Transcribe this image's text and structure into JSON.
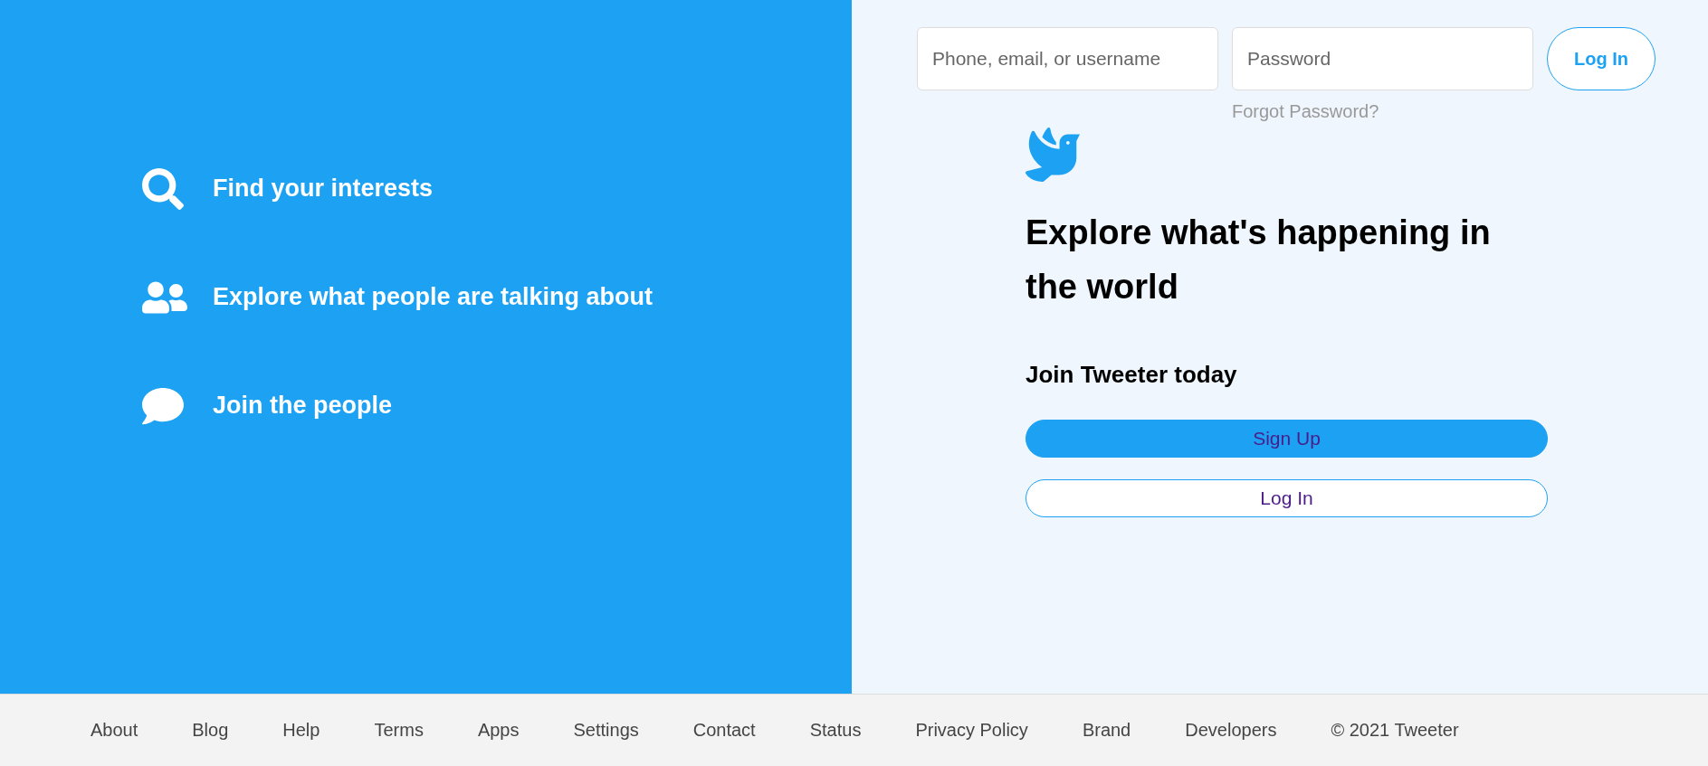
{
  "features": [
    {
      "kind": "search",
      "text": "Find your interests"
    },
    {
      "kind": "people",
      "text": "Explore what people are talking about"
    },
    {
      "kind": "chat",
      "text": "Join the people"
    }
  ],
  "login": {
    "username": {
      "placeholder": "Phone, email, or username"
    },
    "password": {
      "placeholder": "Password"
    },
    "button": "Log In",
    "forgot": "Forgot Password?"
  },
  "headline": "Explore what's happening in the world",
  "subheading": "Join Tweeter today",
  "buttons": [
    {
      "kind": "primary",
      "label": "Sign Up"
    },
    {
      "kind": "outline",
      "label": "Log In"
    }
  ],
  "footer": {
    "links": [
      "About",
      "Blog",
      "Help",
      "Terms",
      "Apps",
      "Settings",
      "Contact",
      "Status",
      "Privacy Policy",
      "Brand",
      "Developers"
    ],
    "copyright": "© 2021 Tweeter"
  }
}
